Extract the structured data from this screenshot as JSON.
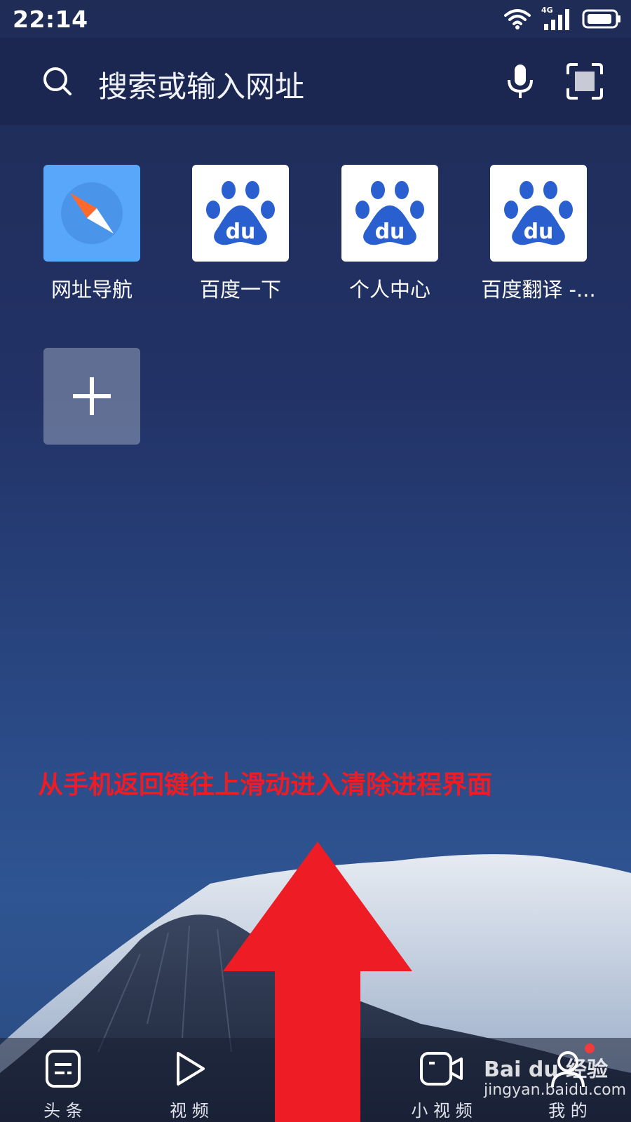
{
  "status_bar": {
    "time": "22:14",
    "network": "4G"
  },
  "search": {
    "placeholder": "搜索或输入网址"
  },
  "shortcuts": [
    {
      "label": "网址导航",
      "icon": "compass-icon"
    },
    {
      "label": "百度一下",
      "icon": "baidu-paw-icon"
    },
    {
      "label": "个人中心",
      "icon": "baidu-paw-icon"
    },
    {
      "label": "百度翻译 -...",
      "icon": "baidu-paw-icon"
    }
  ],
  "baidu_logo_text": "du",
  "instruction": "从手机返回键往上滑动进入清除进程界面",
  "bottom_nav": [
    {
      "label": "头 条",
      "icon": "news-icon"
    },
    {
      "label": "视 频",
      "icon": "play-icon"
    },
    {
      "label": "小 视 频",
      "icon": "small-video-icon"
    },
    {
      "label": "我 的",
      "icon": "profile-icon"
    }
  ],
  "watermark": {
    "brand": "Bai du 经验",
    "url": "jingyan.baidu.com"
  },
  "colors": {
    "accent_red": "#ee1c25",
    "baidu_blue": "#2a5fd0",
    "compass_bg": "#58a7fb",
    "notification_dot": "#f03c3c"
  }
}
